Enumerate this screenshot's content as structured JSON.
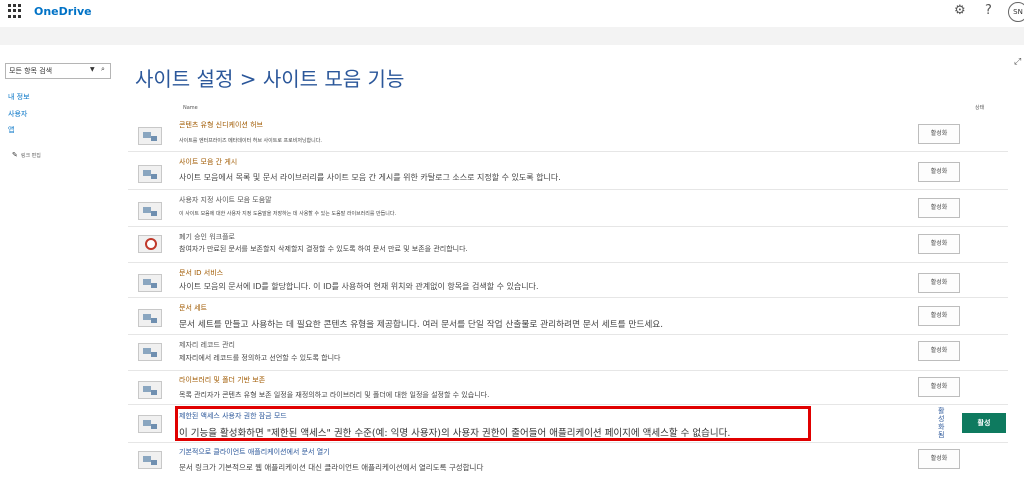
{
  "header": {
    "app_name": "OneDrive",
    "user_initials": "SN",
    "icons": [
      "waffle-icon",
      "gear-icon",
      "help-icon",
      "avatar",
      "focus-icon"
    ]
  },
  "leftnav": {
    "search_placeholder": "모든 항목 검색",
    "items": [
      "내 정보",
      "사용자",
      "앱"
    ],
    "edit_links": "링크 편집"
  },
  "main": {
    "title": "사이트 설정 > 사이트 모음 기능",
    "col_name": "Name",
    "col_status": "상태",
    "features": [
      {
        "title": "콘텐츠 유형 신디케이션 허브",
        "desc": "사이트를 엔터프라이즈 메타데이터 허브 사이트로 프로비저닝합니다.",
        "button": "활성화"
      },
      {
        "title": "사이트 모음 간 게시",
        "desc": "사이트 모음에서 목록 및 문서 라이브러리를 사이트 모음 간 게시를 위한 카탈로그 소스로 지정할 수 있도록 합니다.",
        "button": "활성화"
      },
      {
        "title": "사용자 지정 사이트 모음 도움말",
        "desc": "이 사이트 모음에 대한 사용자 지정 도움말을 저장하는 데 사용할 수 있는 도움말 라이브러리를 만듭니다.",
        "button": "활성화"
      },
      {
        "title": "폐기 승인 워크플로",
        "desc": "참여자가 만료된 문서를 보존할지 삭제할지 결정할 수 있도록 하여 문서 만료 및 보존을 관리합니다.",
        "button": "활성화"
      },
      {
        "title": "문서 ID 서비스",
        "desc": "사이트 모음의 문서에 ID를 할당합니다. 이 ID를 사용하여 현재 위치와 관계없이 항목을 검색할 수 있습니다.",
        "button": "활성화"
      },
      {
        "title": "문서 세트",
        "desc": "문서 세트를 만들고 사용하는 데 필요한 콘텐츠 유형을 제공합니다. 여러 문서를 단일 작업 산출물로 관리하려면 문서 세트를 만드세요.",
        "button": "활성화"
      },
      {
        "title": "제자리 레코드 관리",
        "desc": "제자리에서 레코드를 정의하고 선언할 수 있도록 합니다",
        "button": "활성화"
      },
      {
        "title": "라이브러리 및 폴더 기반 보존",
        "desc": "목록 관리자가 콘텐츠 유형 보존 일정을 재정의하고 라이브러리 및 폴더에 대한 일정을 설정할 수 있습니다.",
        "button": "활성화"
      },
      {
        "title": "제한된 액세스 사용자 권한 잠금 모드",
        "desc": "이 기능을 활성화하면 \"제한된 액세스\" 권한 수준(예: 익명 사용자)의 사용자 권한이 줄어들어 애플리케이션 페이지에 액세스할 수 없습니다.",
        "status_label": "활성화됨",
        "button": "활성"
      },
      {
        "title": "기본적으로 클라이언트 애플리케이션에서 문서 열기",
        "desc": "문서 링크가 기본적으로 웹 애플리케이션 대신 클라이언트 애플리케이션에서 열리도록 구성합니다",
        "button": "활성화"
      }
    ]
  },
  "colors": {
    "brand": "#0072c6",
    "title": "#2b579a",
    "feature_title": "#a05a00",
    "highlight": "#e00000",
    "active": "#0e7a5f"
  }
}
